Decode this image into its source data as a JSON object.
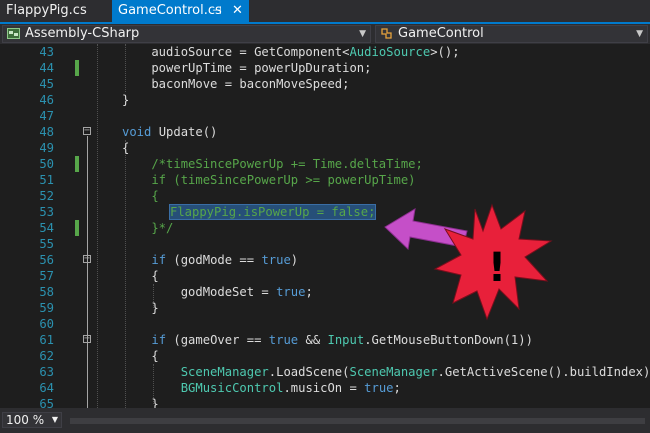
{
  "tabs": [
    {
      "label": "FlappyPig.cs",
      "active": false
    },
    {
      "label": "GameControl.cs",
      "active": true,
      "pin_icon": "pin-icon",
      "close_icon": "close-icon"
    }
  ],
  "navbar": {
    "project": "Assembly-CSharp",
    "class": "GameControl"
  },
  "lines": [
    {
      "n": "43",
      "segs": [
        [
          "t",
          "    audioSource = GetComponent<"
        ],
        [
          "ty",
          "AudioSource"
        ],
        [
          "t",
          ">();"
        ]
      ]
    },
    {
      "n": "44",
      "segs": [
        [
          "t",
          "    powerUpTime = powerUpDuration;"
        ]
      ]
    },
    {
      "n": "45",
      "segs": [
        [
          "t",
          "    baconMove = baconMoveSpeed;"
        ]
      ]
    },
    {
      "n": "46",
      "segs": [
        [
          "t",
          "}"
        ]
      ]
    },
    {
      "n": "47",
      "segs": []
    },
    {
      "n": "48",
      "segs": [
        [
          "kw",
          "void"
        ],
        [
          "t",
          " Update()"
        ]
      ]
    },
    {
      "n": "49",
      "segs": [
        [
          "t",
          "{"
        ]
      ]
    },
    {
      "n": "50",
      "segs": [
        [
          "cm",
          "    /*timeSincePowerUp += Time.deltaTime;"
        ]
      ]
    },
    {
      "n": "51",
      "segs": [
        [
          "cm",
          "    if (timeSincePowerUp >= powerUpTime)"
        ]
      ]
    },
    {
      "n": "52",
      "segs": [
        [
          "cm",
          "    {"
        ]
      ]
    },
    {
      "n": "53",
      "segs": [
        [
          "cm",
          "        FlappyPig.isPowerUp = false;"
        ]
      ]
    },
    {
      "n": "54",
      "segs": [
        [
          "cm",
          "    }*/"
        ]
      ]
    },
    {
      "n": "55",
      "segs": []
    },
    {
      "n": "56",
      "segs": [
        [
          "t",
          "    "
        ],
        [
          "kw",
          "if"
        ],
        [
          "t",
          " (godMode == "
        ],
        [
          "kw",
          "true"
        ],
        [
          "t",
          ")"
        ]
      ]
    },
    {
      "n": "57",
      "segs": [
        [
          "t",
          "    {"
        ]
      ]
    },
    {
      "n": "58",
      "segs": [
        [
          "t",
          "        godModeSet = "
        ],
        [
          "kw",
          "true"
        ],
        [
          "t",
          ";"
        ]
      ]
    },
    {
      "n": "59",
      "segs": [
        [
          "t",
          "    }"
        ]
      ]
    },
    {
      "n": "60",
      "segs": []
    },
    {
      "n": "61",
      "segs": [
        [
          "t",
          "    "
        ],
        [
          "kw",
          "if"
        ],
        [
          "t",
          " (gameOver == "
        ],
        [
          "kw",
          "true"
        ],
        [
          "t",
          " && "
        ],
        [
          "ty",
          "Input"
        ],
        [
          "t",
          ".GetMouseButtonDown(1))"
        ]
      ]
    },
    {
      "n": "62",
      "segs": [
        [
          "t",
          "    {"
        ]
      ]
    },
    {
      "n": "63",
      "segs": [
        [
          "t",
          "        "
        ],
        [
          "ty",
          "SceneManager"
        ],
        [
          "t",
          ".LoadScene("
        ],
        [
          "ty",
          "SceneManager"
        ],
        [
          "t",
          ".GetActiveScene().buildIndex);"
        ]
      ]
    },
    {
      "n": "64",
      "segs": [
        [
          "t",
          "        "
        ],
        [
          "ty",
          "BGMusicControl"
        ],
        [
          "t",
          ".musicOn = "
        ],
        [
          "kw",
          "true"
        ],
        [
          "t",
          ";"
        ]
      ]
    },
    {
      "n": "65",
      "segs": [
        [
          "t",
          "    }"
        ]
      ]
    }
  ],
  "annotation": {
    "symbol": "!",
    "arrow_color": "#c54fc8",
    "burst_color": "#e8203a"
  },
  "status": {
    "zoom": "100 %"
  }
}
